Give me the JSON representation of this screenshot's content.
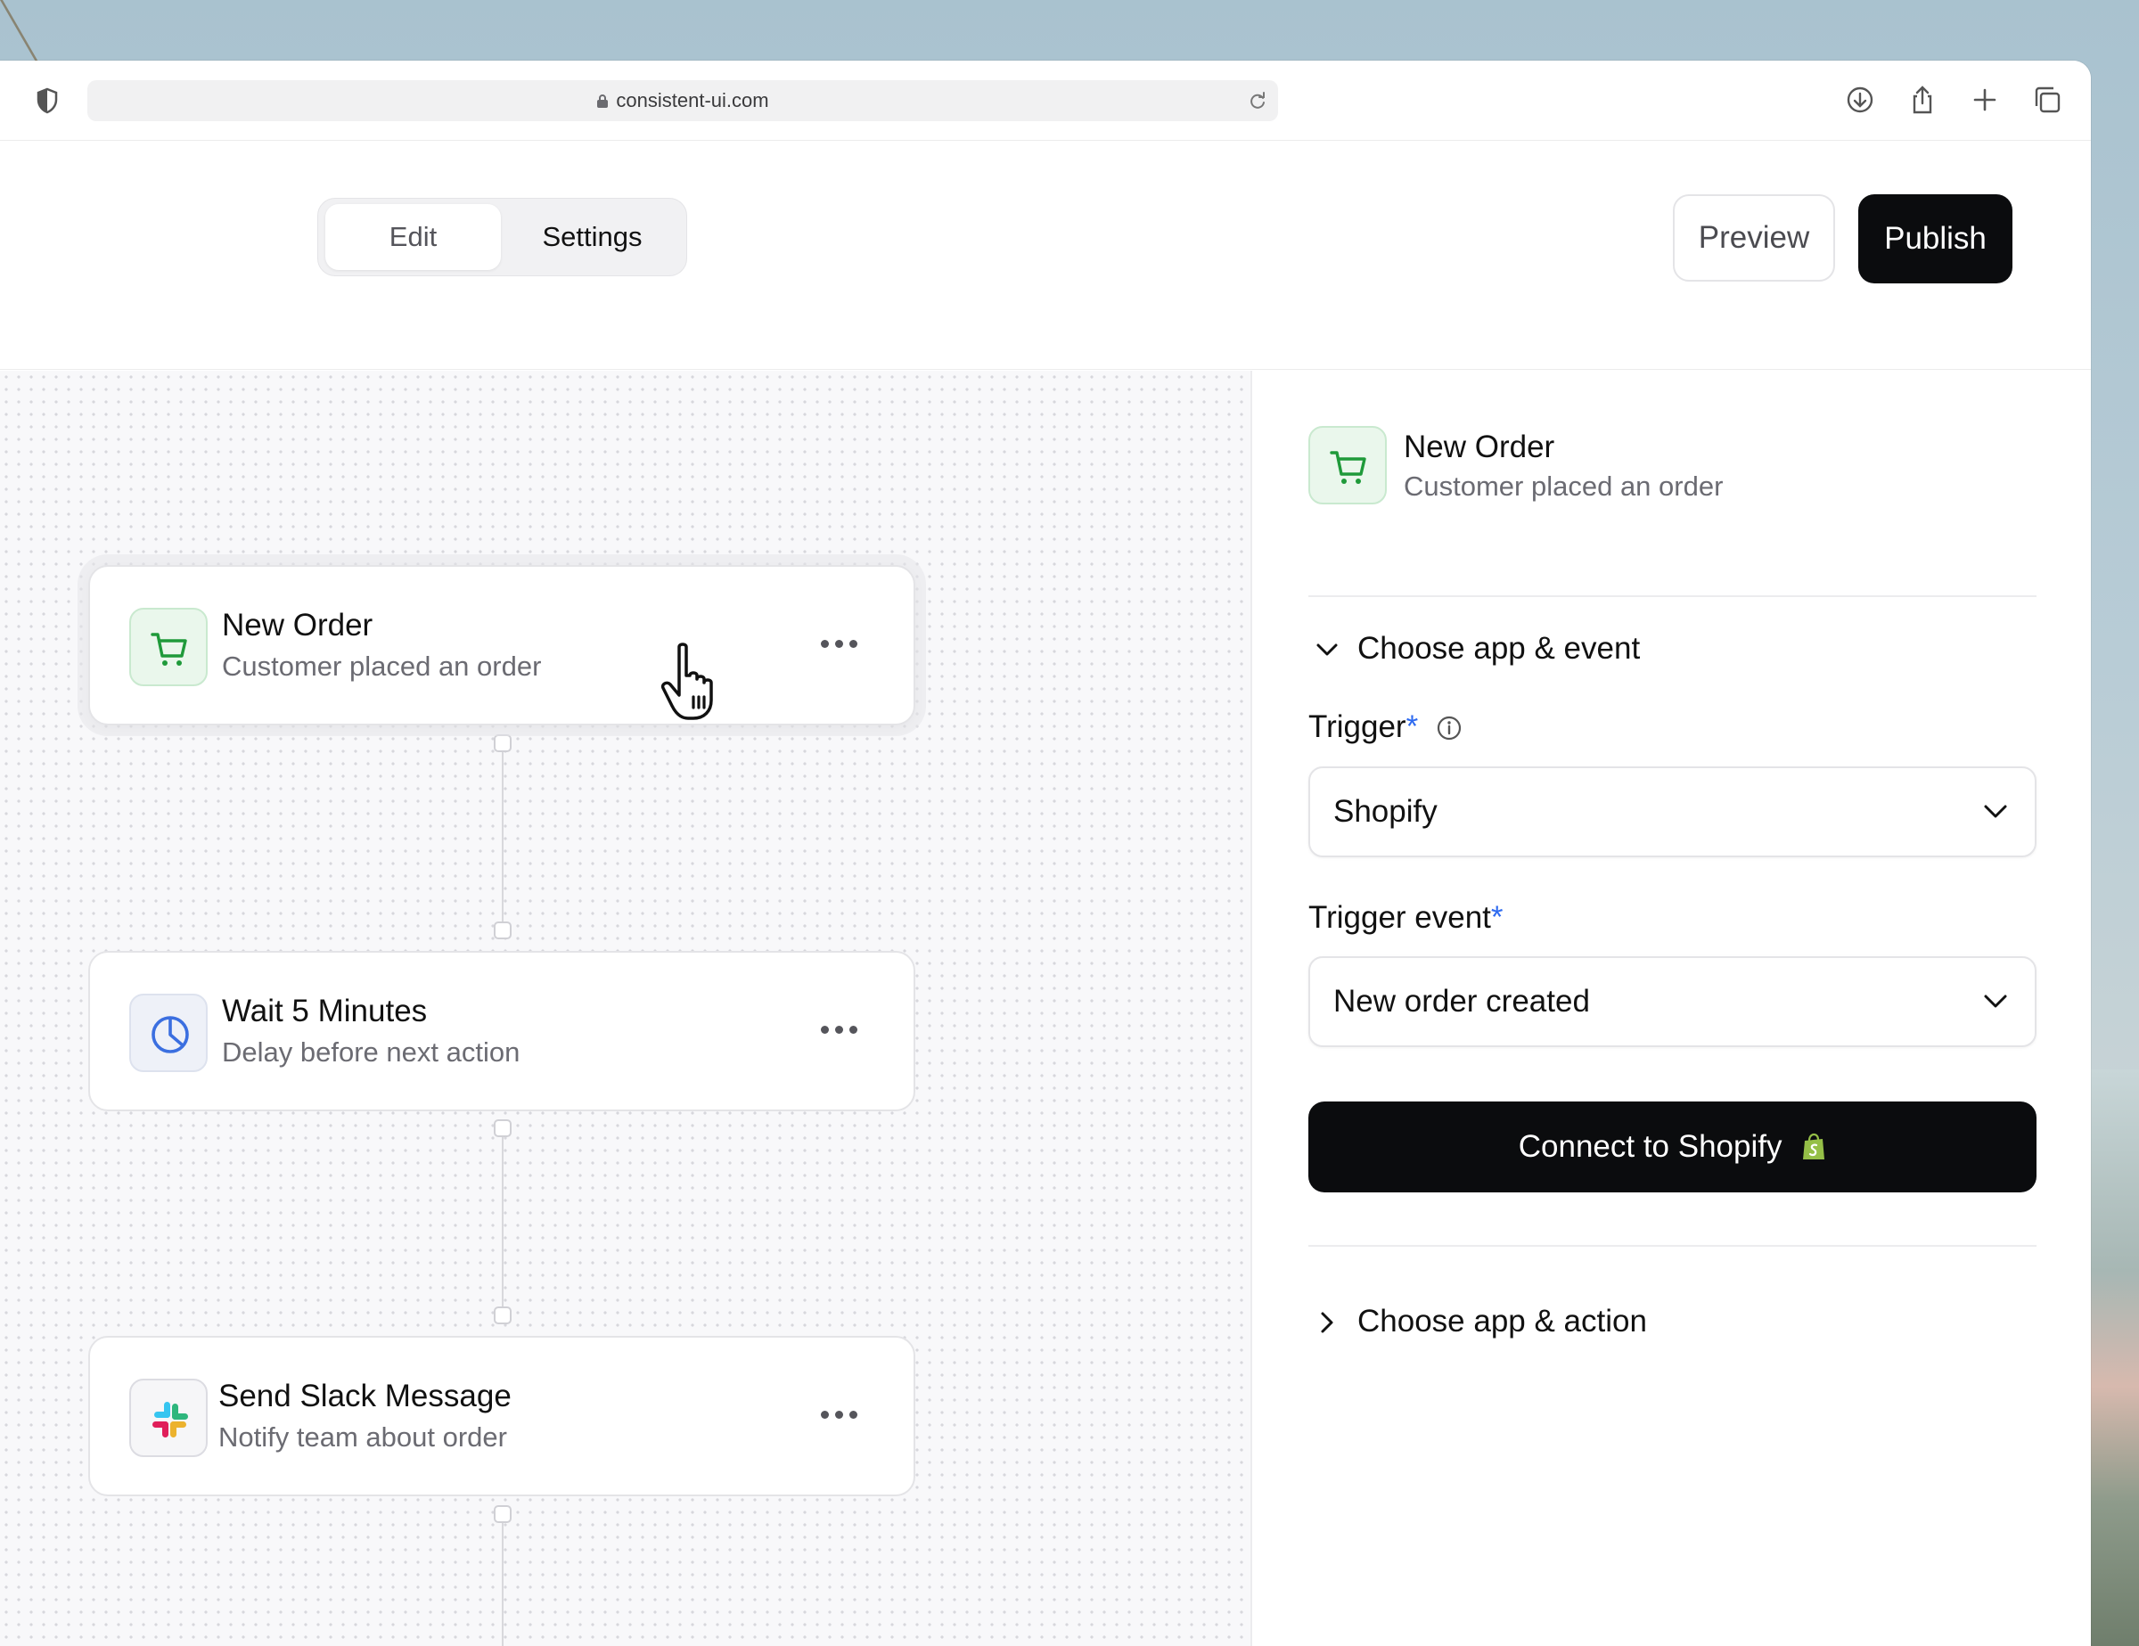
{
  "browser": {
    "url": "consistent-ui.com"
  },
  "header": {
    "tabs": [
      {
        "label": "Edit",
        "active": true
      },
      {
        "label": "Settings",
        "active": false
      }
    ],
    "preview_label": "Preview",
    "publish_label": "Publish"
  },
  "canvas": {
    "nodes": [
      {
        "title": "New Order",
        "subtitle": "Customer placed an order",
        "icon": "shopping-cart-icon",
        "selected": true
      },
      {
        "title": "Wait 5 Minutes",
        "subtitle": "Delay before next action",
        "icon": "clock-icon",
        "selected": false
      },
      {
        "title": "Send Slack Message",
        "subtitle": "Notify team about order",
        "icon": "slack-icon",
        "selected": false
      }
    ]
  },
  "panel": {
    "title": "New Order",
    "subtitle": "Customer placed an order",
    "section_event": "Choose app & event",
    "trigger_label": "Trigger",
    "trigger_required": "*",
    "trigger_value": "Shopify",
    "trigger_event_label": "Trigger event",
    "trigger_event_required": "*",
    "trigger_event_value": "New order created",
    "connect_label": "Connect to Shopify",
    "section_action": "Choose app & action"
  },
  "colors": {
    "accent_dark": "#0b0c0e",
    "required_star": "#2f6bf0",
    "cart_green": "#1f9a3a",
    "clock_blue": "#3b6fe0"
  }
}
